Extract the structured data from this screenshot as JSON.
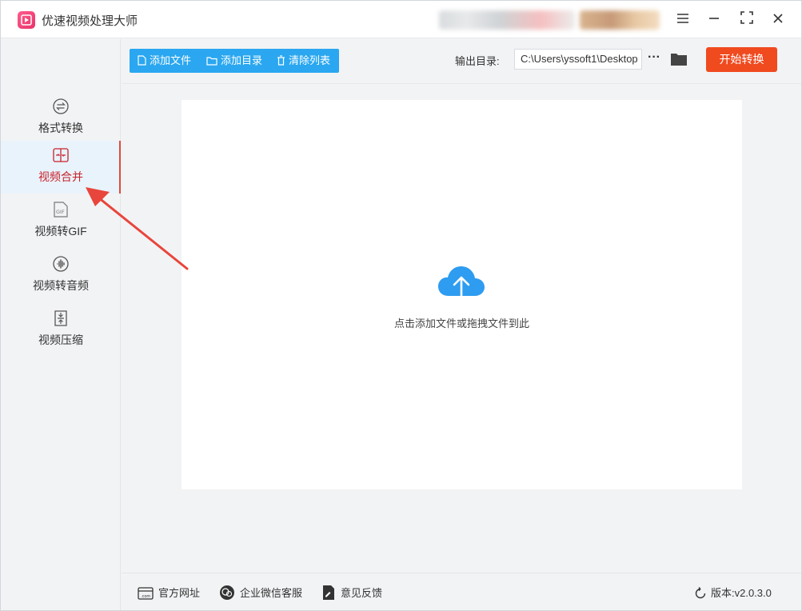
{
  "app": {
    "title": "优速视频处理大师"
  },
  "sidebar": {
    "items": [
      {
        "label": "格式转换",
        "icon": "format-convert-icon"
      },
      {
        "label": "视频合并",
        "icon": "video-merge-icon",
        "active": true
      },
      {
        "label": "视频转GIF",
        "icon": "gif-icon"
      },
      {
        "label": "视频转音频",
        "icon": "audio-icon"
      },
      {
        "label": "视频压缩",
        "icon": "compress-icon"
      }
    ]
  },
  "toolbar": {
    "add_file": "添加文件",
    "add_dir": "添加目录",
    "clear_list": "清除列表",
    "output_label": "输出目录:",
    "output_path": "C:\\Users\\yssoft1\\Desktop",
    "more": "···",
    "start": "开始转换"
  },
  "dropzone": {
    "hint": "点击添加文件或拖拽文件到此"
  },
  "footer": {
    "website": "官方网址",
    "wechat": "企业微信客服",
    "feedback": "意见反馈",
    "version": "版本:v2.0.3.0"
  },
  "colors": {
    "accent_blue": "#2aa7f0",
    "start_orange": "#f04a1f",
    "active_red": "#c8222a",
    "annotation_arrow": "#e8453c"
  }
}
